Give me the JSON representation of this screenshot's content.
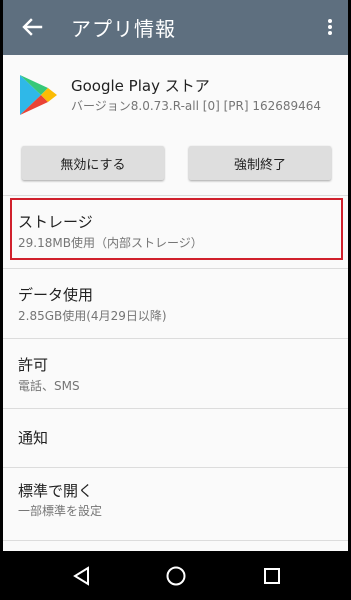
{
  "appbar": {
    "title": "アプリ情報",
    "back_icon": "arrow-back-icon",
    "more_icon": "more-vert-icon",
    "color": "#5e6f7f"
  },
  "app": {
    "name": "Google Play ストア",
    "version": "バージョン8.0.73.R-all [0] [PR] 162689464",
    "icon": "google-play-icon"
  },
  "buttons": {
    "disable": "無効にする",
    "force_stop": "強制終了"
  },
  "settings": [
    {
      "title": "ストレージ",
      "subtitle": "29.18MB使用（内部ストレージ）",
      "highlighted": true
    },
    {
      "title": "データ使用",
      "subtitle": "2.85GB使用(4月29日以降)"
    },
    {
      "title": "許可",
      "subtitle": "電話、SMS"
    },
    {
      "title": "通知"
    },
    {
      "title": "標準で開く",
      "subtitle": "一部標準を設定"
    }
  ],
  "navbar": {
    "back_icon": "nav-back-icon",
    "home_icon": "nav-home-icon",
    "recents_icon": "nav-recents-icon"
  },
  "colors": {
    "highlight_border": "#d0202c",
    "background": "#fafafa"
  }
}
